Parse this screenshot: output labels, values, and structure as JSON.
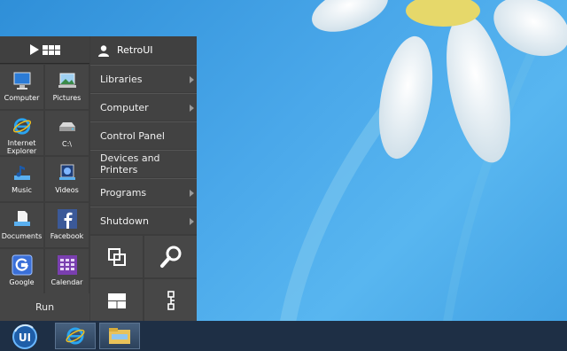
{
  "start_menu": {
    "user_name": "RetroUI",
    "tiles": [
      {
        "label": "Computer",
        "icon": "computer-icon"
      },
      {
        "label": "Pictures",
        "icon": "pictures-icon"
      },
      {
        "label": "Internet\nExplorer",
        "icon": "internet-explorer-icon"
      },
      {
        "label": "C:\\",
        "icon": "drive-icon"
      },
      {
        "label": "Music",
        "icon": "music-icon"
      },
      {
        "label": "Videos",
        "icon": "videos-icon"
      },
      {
        "label": "Documents",
        "icon": "documents-icon"
      },
      {
        "label": "Facebook",
        "icon": "facebook-icon"
      },
      {
        "label": "Google",
        "icon": "google-icon"
      },
      {
        "label": "Calendar",
        "icon": "calendar-icon"
      }
    ],
    "run_label": "Run",
    "menu_items": [
      {
        "label": "Libraries",
        "has_submenu": true
      },
      {
        "label": "Computer",
        "has_submenu": true
      },
      {
        "label": "Control Panel",
        "has_submenu": false
      },
      {
        "label": "Devices and Printers",
        "has_submenu": false
      },
      {
        "label": "Programs",
        "has_submenu": true
      },
      {
        "label": "Shutdown",
        "has_submenu": true
      }
    ],
    "utility_buttons": [
      "switch-windows-icon",
      "search-icon",
      "layout-icon",
      "connect-icon"
    ]
  },
  "taskbar": {
    "start_logo_text": "UI",
    "pinned": [
      "internet-explorer-icon",
      "file-explorer-icon"
    ]
  },
  "colors": {
    "menu_bg": "#3c3c3c",
    "tile_bg": "#454545",
    "taskbar_bg": "#1e2f45",
    "wallpaper": "#4aa8ea"
  }
}
